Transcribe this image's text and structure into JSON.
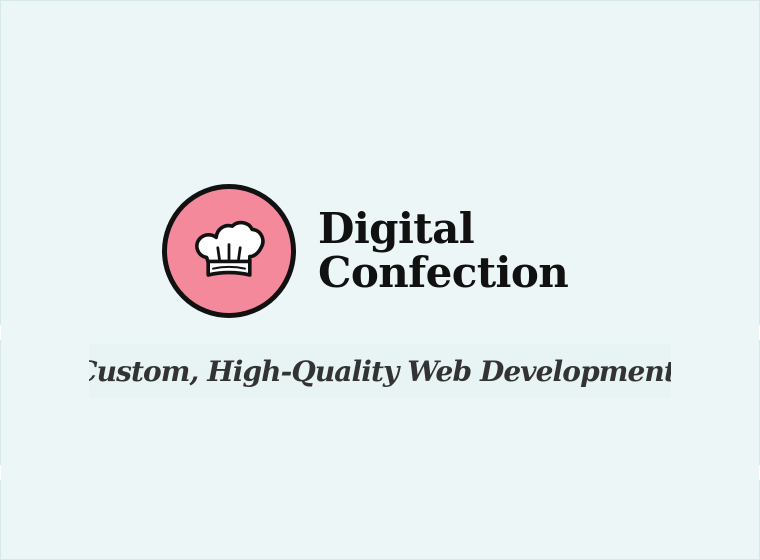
{
  "brand": {
    "name_line1": "Digital",
    "name_line2": "Confection",
    "logo_icon": "chef-hat-icon"
  },
  "tagline": "Custom, High-Quality Web Development.",
  "colors": {
    "background": "#ecf6f7",
    "logo_fill": "#f3899a",
    "logo_outline": "#111111",
    "brand_text": "#111111",
    "tagline_text": "#333333"
  }
}
